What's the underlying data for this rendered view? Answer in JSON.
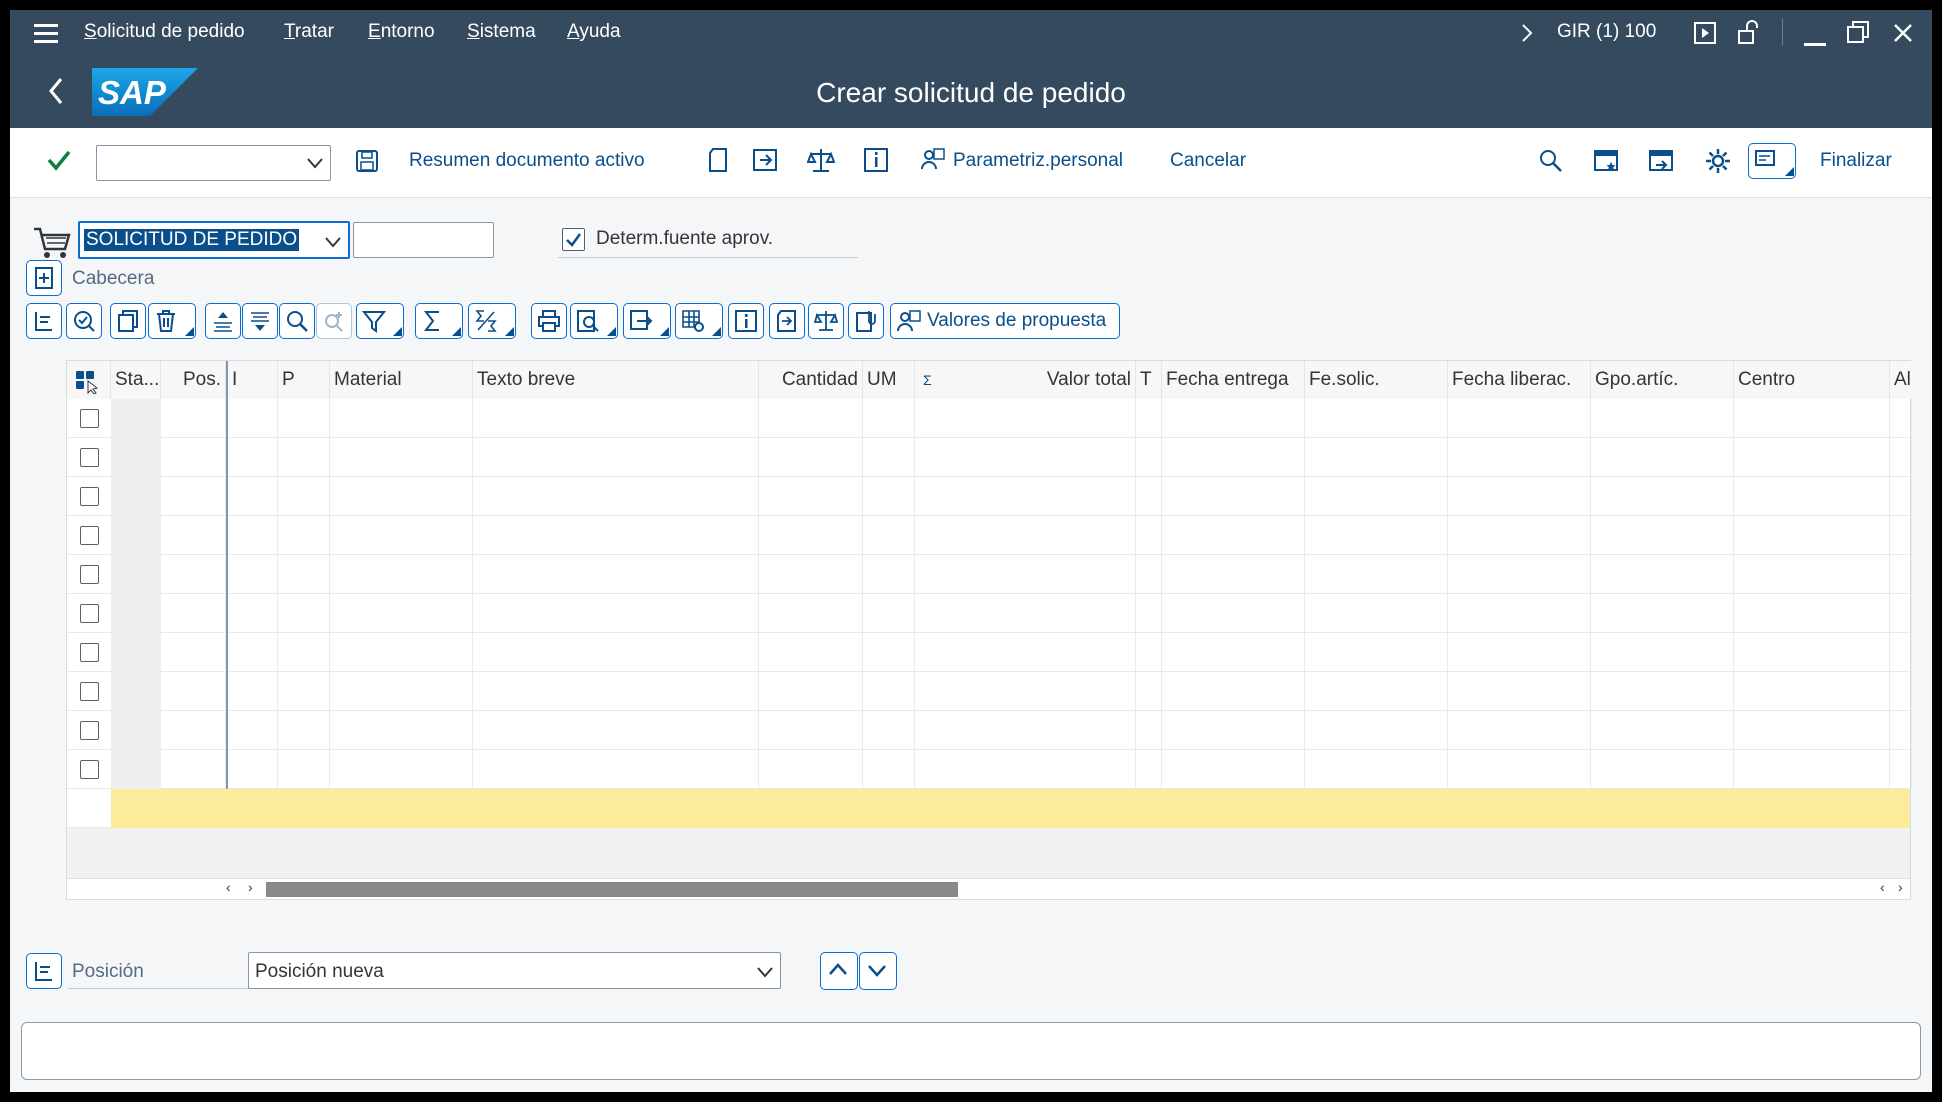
{
  "menubar": {
    "items": [
      {
        "label": "Solicitud de pedido",
        "accel": "S",
        "rest": "olicitud de pedido"
      },
      {
        "label": "Tratar",
        "accel": "T",
        "rest": "ratar"
      },
      {
        "label": "Entorno",
        "accel": "E",
        "rest": "ntorno"
      },
      {
        "label": "Sistema",
        "accel": "S",
        "rest": "istema"
      },
      {
        "label": "Ayuda",
        "accel": "A",
        "rest": "yuda"
      }
    ],
    "system_info": "GIR (1) 100"
  },
  "header": {
    "title": "Crear solicitud de pedido",
    "logo_text": "SAP"
  },
  "toolbar": {
    "command_field_value": "",
    "links": {
      "resumen": "Resumen documento activo",
      "parametriz": "Parametriz.personal",
      "cancelar": "Cancelar",
      "finalizar": "Finalizar"
    }
  },
  "form": {
    "doc_type_value": "SOLICITUD DE PEDIDO",
    "doc_number_value": "",
    "determ_label": "Determ.fuente aprov.",
    "determ_checked": true,
    "cabecera_label": "Cabecera"
  },
  "grid_toolbar": {
    "valores_label": "Valores de propuesta"
  },
  "grid": {
    "columns": {
      "sta": "Sta...",
      "pos": "Pos.",
      "i": "I",
      "p": "P",
      "material": "Material",
      "texto_breve": "Texto breve",
      "cantidad": "Cantidad",
      "um": "UM",
      "sigma": "Σ",
      "valor_total": "Valor total",
      "t": "T",
      "fecha_entrega": "Fecha entrega",
      "fe_solic": "Fe.solic.",
      "fecha_liberac": "Fecha liberac.",
      "gpo_artic": "Gpo.artíc.",
      "centro": "Centro",
      "al": "Al"
    },
    "row_count": 10
  },
  "position": {
    "label": "Posición",
    "select_value": "Posición nueva"
  },
  "colors": {
    "shell": "#354a5f",
    "link": "#0a4f8c",
    "accent": "#0a6ed1",
    "highlight_row": "#fdeb9c"
  }
}
